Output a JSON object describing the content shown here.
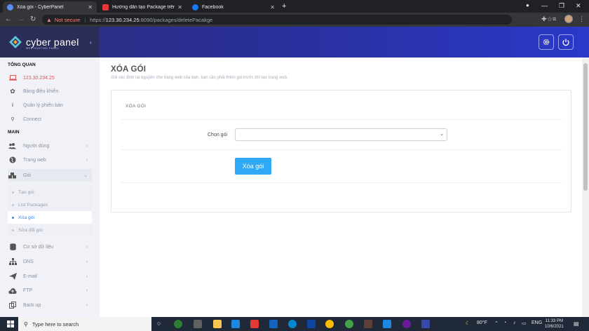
{
  "browser": {
    "tabs": [
      {
        "title": "Xóa gói - CyberPanel",
        "fav_color": "#5b8def"
      },
      {
        "title": "Hướng dẫn tạo Package trên Cy…",
        "fav_color": "#e53935"
      },
      {
        "title": "Facebook",
        "fav_color": "#1877f2"
      }
    ],
    "security_label": "Not secure",
    "url_scheme": "https://",
    "url_host": "123.30.234.25",
    "url_path": ":8090/packages/deletePacakge"
  },
  "header": {
    "logo_text": "cyber panel",
    "logo_sub": "WEB HOSTING PANEL"
  },
  "sidebar": {
    "section_overview": "TỔNG QUAN",
    "ip": "123.30.234.25",
    "dashboard": "Bảng điều khiển",
    "version": "Quản lý phiên bản",
    "connect": "Connect",
    "section_main": "MAIN",
    "users": "Người dùng",
    "websites": "Trang web",
    "packages": "Gói",
    "packages_sub": [
      "Tạo gói",
      "List Packages",
      "Xóa gói",
      "Sửa đổi gói"
    ],
    "databases": "Cơ sở dữ liệu",
    "dns": "DNS",
    "email": "E-mail",
    "ftp": "FTP",
    "backup": "Back up"
  },
  "main": {
    "title": "XÓA GÓI",
    "description": "Gói xác định tài nguyên cho trang web của bạn, bạn cần phải thêm gói trước khi tạo trang web.",
    "card_title": "XÓA GÓI",
    "field_label": "Chọn gói",
    "select_value": "",
    "button_label": "Xóa gói"
  },
  "taskbar": {
    "search_placeholder": "Type here to search",
    "weather": "80°F",
    "lang": "ENG",
    "time": "11:33 PM",
    "date": "10/6/2021"
  }
}
